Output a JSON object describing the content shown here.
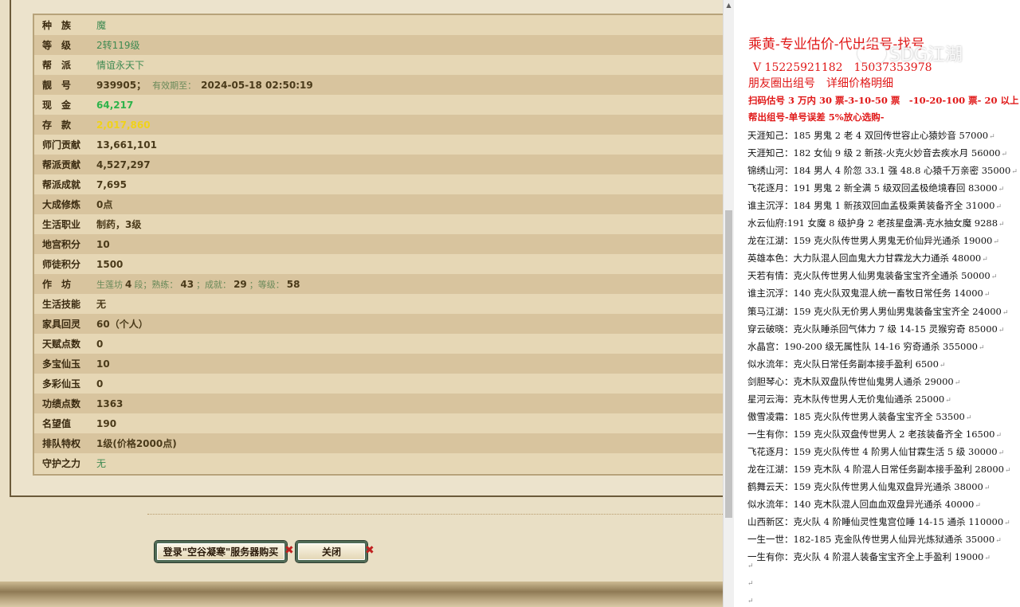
{
  "info_rows": [
    {
      "label": "种　族",
      "value": "魔",
      "style": "green"
    },
    {
      "label": "等　级",
      "value": "2转119级",
      "style": "green"
    },
    {
      "label": "帮　派",
      "value": "情谊永天下",
      "style": "green"
    },
    {
      "label": "靓　号",
      "value": "939905；",
      "extra_label": "有效期至：",
      "extra_value": "2024-05-18 02:50:19"
    },
    {
      "label": "现　金",
      "value": "64,217",
      "style": "brightgreen"
    },
    {
      "label": "存　款",
      "value": "2,017,860",
      "style": "yellow"
    },
    {
      "label": "师门贡献",
      "value": "13,661,101"
    },
    {
      "label": "帮派贡献",
      "value": "4,527,297"
    },
    {
      "label": "帮派成就",
      "value": "7,695"
    },
    {
      "label": "大成修炼",
      "value": "0点"
    },
    {
      "label": "生活职业",
      "value": "制药，3级"
    },
    {
      "label": "地宫积分",
      "value": "10"
    },
    {
      "label": "师徒积分",
      "value": "1500"
    },
    {
      "label": "作　坊",
      "workshop": {
        "prefix": "生莲坊",
        "level": "4",
        "level_unit": "段；",
        "skill_label": "熟练：",
        "skill": "43",
        "ach_label": "；成就：",
        "ach": "29",
        "grade_label": "；等级：",
        "grade": "58"
      }
    },
    {
      "label": "生活技能",
      "value": "无"
    },
    {
      "label": "家具回灵",
      "value": "60（个人）"
    },
    {
      "label": "天赋点数",
      "value": "0"
    },
    {
      "label": "多宝仙玉",
      "value": "10"
    },
    {
      "label": "多彩仙玉",
      "value": "0"
    },
    {
      "label": "功绩点数",
      "value": "1363"
    },
    {
      "label": "名望值",
      "value": "190"
    },
    {
      "label": "排队特权",
      "value": "1级(价格2000点)"
    },
    {
      "label": "守护之力",
      "value": "无",
      "style": "green"
    }
  ],
  "buttons": {
    "login_label": "登录\"空谷凝寒\"服务器购买",
    "close_label": "关闭",
    "x_mark": "✖"
  },
  "doc": {
    "title": "乘黄-专业估价-代出组号-找号",
    "phone": "V 15225921182　15037353978",
    "subtitle": "朋友圈出组号　详细价格明细",
    "red_line1": "扫码估号 3 万内 30 票-3-10-50 票　-10-20-100 票- 20 以上 150",
    "red_line2": "帮出组号-单号误差 5%放心选购-",
    "watermark": "SDG江湖",
    "return_mark": "↵",
    "listings": [
      "天涯知己：185 男鬼 2 老 4 双回传世容止心猿妙音 57000",
      "天涯知己：182 女仙 9 级 2 新孩-火克火妙音去疾水月 56000",
      "锦绣山河：184 男人 4 阶忽 33.1 强 48.8 心猿千万亲密 35000",
      "飞花逐月：191 男鬼 2 新全满 5 级双回孟极绝境春回 83000",
      "谁主沉浮：184 男鬼 1 新孩双回血孟极乘黄装备齐全 31000",
      "水云仙府:191 女魔 8 级护身 2 老孩星盘满-克水抽女魔 9288",
      "龙在江湖：159 克火队传世男人男鬼无价仙异光通杀 19000",
      "英雄本色：大力队混人回血鬼大力甘霖龙大力通杀 48000",
      "天若有情：克火队传世男人仙男鬼装备宝宝齐全通杀 50000",
      "谁主沉浮：140 克火队双鬼混人统一畜牧日常任务 14000",
      "策马江湖：159 克火队无价男人男仙男鬼装备宝宝齐全 24000",
      "穿云破晓：克火队睡杀回气体力 7 级 14-15 灵猴穷奇 85000",
      "水晶宫：190-200 级无属性队 14-16 穷奇通杀 355000",
      "似水流年：克火队日常任务副本接手盈利 6500",
      "剑胆琴心：克木队双盘队传世仙鬼男人通杀 29000",
      "星河云海：克木队传世男人无价鬼仙通杀 25000",
      "傲雪凌霜：185 克火队传世男人装备宝宝齐全 53500",
      "一生有你：159 克火队双盘传世男人 2 老孩装备齐全 16500",
      "飞花逐月：159 克火队传世 4 阶男人仙甘霖生活 5 级 30000",
      "龙在江湖：159 克木队 4 阶混人日常任务副本接手盈利 28000",
      "鹤舞云天：159 克火队传世男人仙鬼双盘异光通杀 38000",
      "似水流年：140 克木队混人回血血双盘异光通杀 40000",
      "山西新区：克火队 4 阶睡仙灵性鬼宫位睡 14-15 通杀 110000",
      "一生一世：182-185 克金队传世男人仙异光炼狱通杀 35000",
      "一生有你：克火队 4 阶混人装备宝宝齐全上手盈利 19000"
    ]
  }
}
